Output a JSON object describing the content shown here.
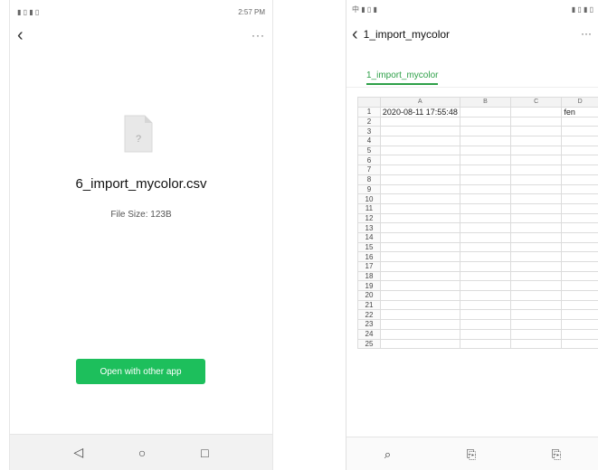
{
  "left": {
    "status": {
      "left": "▮ ▯ ▮ ▯",
      "right": "2:57 PM"
    },
    "back_icon": "‹",
    "more_icon": "···",
    "file_icon": "?",
    "filename": "6_import_mycolor.csv",
    "filesize": "File Size: 123B",
    "open_button": "Open with other app",
    "nav": {
      "back": "◁",
      "home": "○",
      "recent": "□"
    }
  },
  "right": {
    "status": {
      "left": "中 ▮ ▯ ▮",
      "right": "▮ ▯ ▮ ▯"
    },
    "back_icon": "‹",
    "title": "1_import_mycolor",
    "subtitle": "",
    "more_icon": "···",
    "tab": "1_import_mycolor",
    "columns": [
      "A",
      "B",
      "C",
      "D"
    ],
    "rows": [
      {
        "n": "1",
        "a": "2020-08-11 17:55:48",
        "b": "",
        "c": "",
        "d": "fen"
      },
      {
        "n": "2",
        "a": "",
        "b": "",
        "c": "",
        "d": ""
      },
      {
        "n": "3",
        "a": "",
        "b": "",
        "c": "",
        "d": ""
      },
      {
        "n": "4",
        "a": "",
        "b": "",
        "c": "",
        "d": ""
      },
      {
        "n": "5",
        "a": "",
        "b": "",
        "c": "",
        "d": ""
      },
      {
        "n": "6",
        "a": "",
        "b": "",
        "c": "",
        "d": ""
      },
      {
        "n": "7",
        "a": "",
        "b": "",
        "c": "",
        "d": ""
      },
      {
        "n": "8",
        "a": "",
        "b": "",
        "c": "",
        "d": ""
      },
      {
        "n": "9",
        "a": "",
        "b": "",
        "c": "",
        "d": ""
      },
      {
        "n": "10",
        "a": "",
        "b": "",
        "c": "",
        "d": ""
      },
      {
        "n": "11",
        "a": "",
        "b": "",
        "c": "",
        "d": ""
      },
      {
        "n": "12",
        "a": "",
        "b": "",
        "c": "",
        "d": ""
      },
      {
        "n": "13",
        "a": "",
        "b": "",
        "c": "",
        "d": ""
      },
      {
        "n": "14",
        "a": "",
        "b": "",
        "c": "",
        "d": ""
      },
      {
        "n": "15",
        "a": "",
        "b": "",
        "c": "",
        "d": ""
      },
      {
        "n": "16",
        "a": "",
        "b": "",
        "c": "",
        "d": ""
      },
      {
        "n": "17",
        "a": "",
        "b": "",
        "c": "",
        "d": ""
      },
      {
        "n": "18",
        "a": "",
        "b": "",
        "c": "",
        "d": ""
      },
      {
        "n": "19",
        "a": "",
        "b": "",
        "c": "",
        "d": ""
      },
      {
        "n": "20",
        "a": "",
        "b": "",
        "c": "",
        "d": ""
      },
      {
        "n": "21",
        "a": "",
        "b": "",
        "c": "",
        "d": ""
      },
      {
        "n": "22",
        "a": "",
        "b": "",
        "c": "",
        "d": ""
      },
      {
        "n": "23",
        "a": "",
        "b": "",
        "c": "",
        "d": ""
      },
      {
        "n": "24",
        "a": "",
        "b": "",
        "c": "",
        "d": ""
      },
      {
        "n": "25",
        "a": "",
        "b": "",
        "c": "",
        "d": ""
      }
    ],
    "bottom": [
      {
        "icon": "⌕",
        "label": ""
      },
      {
        "icon": "⎘",
        "label": ""
      },
      {
        "icon": "⎘",
        "label": ""
      }
    ]
  }
}
